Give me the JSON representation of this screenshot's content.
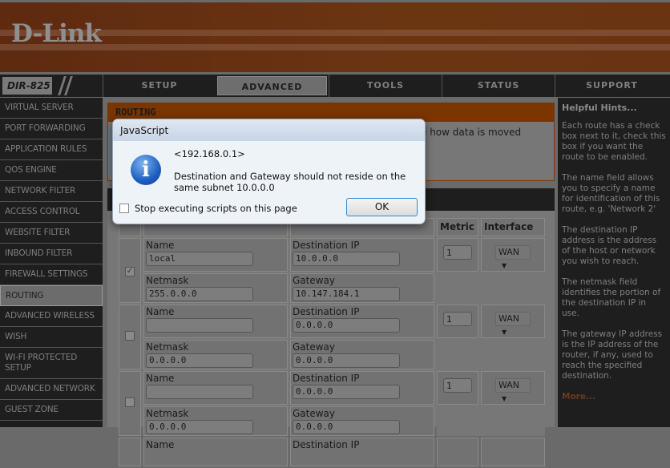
{
  "brand": {
    "logo": "D-Link",
    "model": "DIR-825"
  },
  "nav": {
    "tabs": [
      {
        "label": "SETUP"
      },
      {
        "label": "ADVANCED"
      },
      {
        "label": "TOOLS"
      },
      {
        "label": "STATUS"
      },
      {
        "label": "SUPPORT"
      }
    ]
  },
  "sidebar": {
    "items": [
      "VIRTUAL SERVER",
      "PORT FORWARDING",
      "APPLICATION RULES",
      "QOS ENGINE",
      "NETWORK FILTER",
      "ACCESS CONTROL",
      "WEBSITE FILTER",
      "INBOUND FILTER",
      "FIREWALL SETTINGS",
      "ROUTING",
      "ADVANCED WIRELESS",
      "WISH",
      "WI-FI PROTECTED SETUP",
      "ADVANCED NETWORK",
      "GUEST ZONE"
    ]
  },
  "main": {
    "title": "ROUTING",
    "description_fragment": "e how data is moved"
  },
  "table": {
    "headers": {
      "metric": "Metric",
      "interface": "Interface"
    },
    "labels": {
      "name": "Name",
      "dest": "Destination IP",
      "netmask": "Netmask",
      "gateway": "Gateway"
    },
    "rows": [
      {
        "enabled": true,
        "name": "local",
        "dest": "10.0.0.0",
        "netmask": "255.0.0.0",
        "gateway": "10.147.184.1",
        "metric": "1",
        "interface": "WAN"
      },
      {
        "enabled": false,
        "name": "",
        "dest": "0.0.0.0",
        "netmask": "0.0.0.0",
        "gateway": "0.0.0.0",
        "metric": "1",
        "interface": "WAN"
      },
      {
        "enabled": false,
        "name": "",
        "dest": "0.0.0.0",
        "netmask": "0.0.0.0",
        "gateway": "0.0.0.0",
        "metric": "1",
        "interface": "WAN"
      }
    ]
  },
  "hints": {
    "title": "Helpful Hints...",
    "paragraphs": [
      "Each route has a check box next to it, check this box if you want the route to be enabled.",
      "The name field allows you to specify a name for identification of this route, e.g. 'Network 2'",
      "The destination IP address is the address of the host or network you wish to reach.",
      "The netmask field identifies the portion of the destination IP in use.",
      "The gateway IP address is the IP address of the router, if any, used to reach the specified destination."
    ],
    "more": "More..."
  },
  "dialog": {
    "title": "JavaScript",
    "origin": "<192.168.0.1>",
    "message": "Destination and Gateway should not reside on the same subnet 10.0.0.0",
    "stop_label": "Stop executing scripts on this page",
    "ok_label": "OK"
  }
}
